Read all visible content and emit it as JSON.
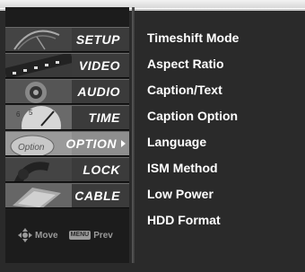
{
  "menu": {
    "items": [
      {
        "label": "SETUP",
        "icon": "satellite-dish-icon"
      },
      {
        "label": "VIDEO",
        "icon": "film-strip-icon"
      },
      {
        "label": "AUDIO",
        "icon": "speaker-icon"
      },
      {
        "label": "TIME",
        "icon": "clock-icon"
      },
      {
        "label": "OPTION",
        "icon": "option-sticker-icon",
        "active": true
      },
      {
        "label": "LOCK",
        "icon": "padlock-icon"
      },
      {
        "label": "CABLE",
        "icon": "cable-icon"
      }
    ]
  },
  "submenu": {
    "items": [
      "Timeshift Mode",
      "Aspect Ratio",
      "Caption/Text",
      "Caption Option",
      "Language",
      "ISM Method",
      "Low Power",
      "HDD Format"
    ]
  },
  "legend": {
    "move_label": "Move",
    "menu_key": "MENU",
    "prev_label": "Prev"
  },
  "colors": {
    "panel_bg": "#2a2a2a",
    "active_bg": "#8e8e8e",
    "text": "#ffffff"
  }
}
